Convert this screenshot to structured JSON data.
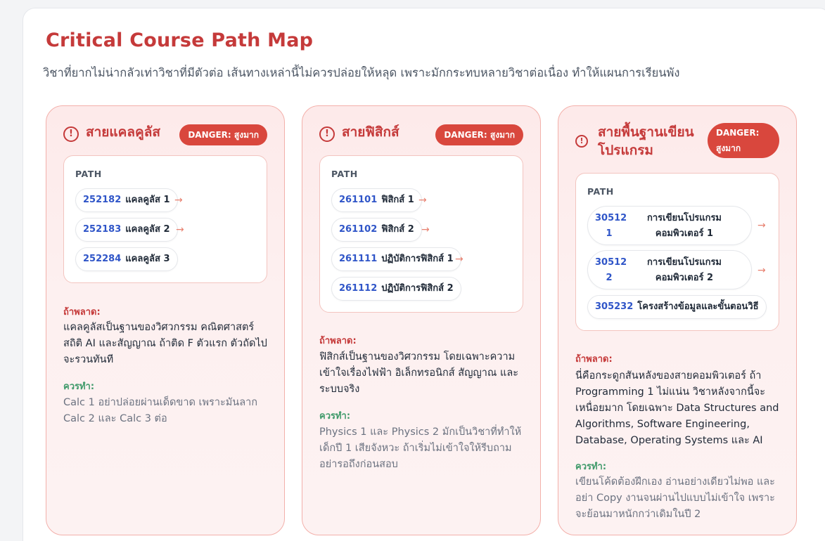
{
  "header": {
    "title": "Critical Course Path Map",
    "subtitle": "วิชาที่ยากไม่น่ากลัวเท่าวิชาที่มีตัวต่อ เส้นทางเหล่านี้ไม่ควรปล่อยให้หลุด เพราะมักกระทบหลายวิชาต่อเนื่อง ทำให้แผนการเรียนพัง"
  },
  "labels": {
    "path": "PATH",
    "if_fail": "ถ้าพลาด:",
    "should_do": "ควรทำ:"
  },
  "icons": {
    "alert": "alert-circle-icon",
    "arrow": "arrow-right-icon"
  },
  "colors": {
    "accent": "#c53a3a",
    "danger_badge": "#d9473d",
    "code": "#2f55c8",
    "should_label": "#3f9a6a"
  },
  "cards": [
    {
      "title": "สายแคลคูลัส",
      "badge": "DANGER: สูงมาก",
      "courses": [
        {
          "code": "252182",
          "name": "แคลคูลัส 1"
        },
        {
          "code": "252183",
          "name": "แคลคูลัส 2"
        },
        {
          "code": "252284",
          "name": "แคลคูลัส 3"
        }
      ],
      "fail_text": "แคลคูลัสเป็นฐานของวิศวกรรม คณิตศาสตร์ สถิติ AI และสัญญาณ ถ้าติด F ตัวแรก ตัวถัดไปจะรวนทันที",
      "do_text": "Calc 1 อย่าปล่อยผ่านเด็ดขาด เพราะมันลาก Calc 2 และ Calc 3 ต่อ"
    },
    {
      "title": "สายฟิสิกส์",
      "badge": "DANGER: สูงมาก",
      "courses": [
        {
          "code": "261101",
          "name": "ฟิสิกส์ 1"
        },
        {
          "code": "261102",
          "name": "ฟิสิกส์ 2"
        },
        {
          "code": "261111",
          "name": "ปฏิบัติการฟิสิกส์ 1"
        },
        {
          "code": "261112",
          "name": "ปฏิบัติการฟิสิกส์ 2"
        }
      ],
      "fail_text": "ฟิสิกส์เป็นฐานของวิศวกรรม โดยเฉพาะความเข้าใจเรื่องไฟฟ้า อิเล็กทรอนิกส์ สัญญาณ และระบบจริง",
      "do_text": "Physics 1 และ Physics 2 มักเป็นวิชาที่ทำให้เด็กปี 1 เสียจังหวะ ถ้าเริ่มไม่เข้าใจให้รีบถามอย่ารอถึงก่อนสอบ"
    },
    {
      "title": "สายพื้นฐานเขียนโปรแกรม",
      "badge": "DANGER: สูงมาก",
      "courses": [
        {
          "code_a": "30512",
          "code_b": "1",
          "name_a": "การเขียนโปรแกรม",
          "name_b": "คอมพิวเตอร์ 1"
        },
        {
          "code_a": "30512",
          "code_b": "2",
          "name_a": "การเขียนโปรแกรม",
          "name_b": "คอมพิวเตอร์ 2"
        },
        {
          "code": "305232",
          "name": "โครงสร้างข้อมูลและขั้นตอนวิธี"
        }
      ],
      "fail_text": "นี่คือกระดูกสันหลังของสายคอมพิวเตอร์ ถ้า Programming 1 ไม่แน่น วิชาหลังจากนี้จะเหนื่อยมาก โดยเฉพาะ Data Structures and Algorithms, Software Engineering, Database, Operating Systems และ AI",
      "do_text": "เขียนโค้ดต้องฝึกเอง อ่านอย่างเดียวไม่พอ และอย่า Copy งานจนผ่านไปแบบไม่เข้าใจ เพราะจะย้อนมาหนักกว่าเดิมในปี 2"
    }
  ]
}
